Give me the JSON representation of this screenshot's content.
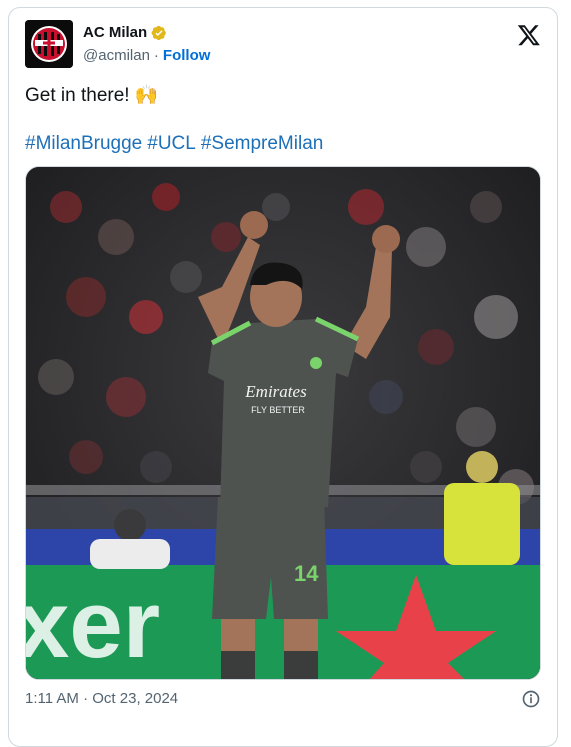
{
  "account": {
    "name": "AC Milan",
    "handle": "@acmilan",
    "separator": "·",
    "follow_label": "Follow"
  },
  "tweet": {
    "text": "Get in there! 🙌",
    "hashtags": [
      "#MilanBrugge",
      "#UCL",
      "#SempreMilan"
    ],
    "timestamp": "1:11 AM · Oct 23, 2024"
  },
  "media": {
    "shirt_sponsor": "Emirates",
    "shirt_sponsor_sub": "FLY BETTER",
    "shirt_number": "14"
  },
  "colors": {
    "link": "#1d70b8",
    "follow": "#006fd6",
    "verified": "#e2b719",
    "kit": "#4e5350",
    "kit_trim": "#7bd36b",
    "pitch_ad": "#1c9a55",
    "star": "#e8414a"
  },
  "icons": {
    "logo": "x-logo-icon",
    "verified": "verified-badge-icon",
    "info": "info-icon",
    "avatar": "ac-milan-crest"
  }
}
